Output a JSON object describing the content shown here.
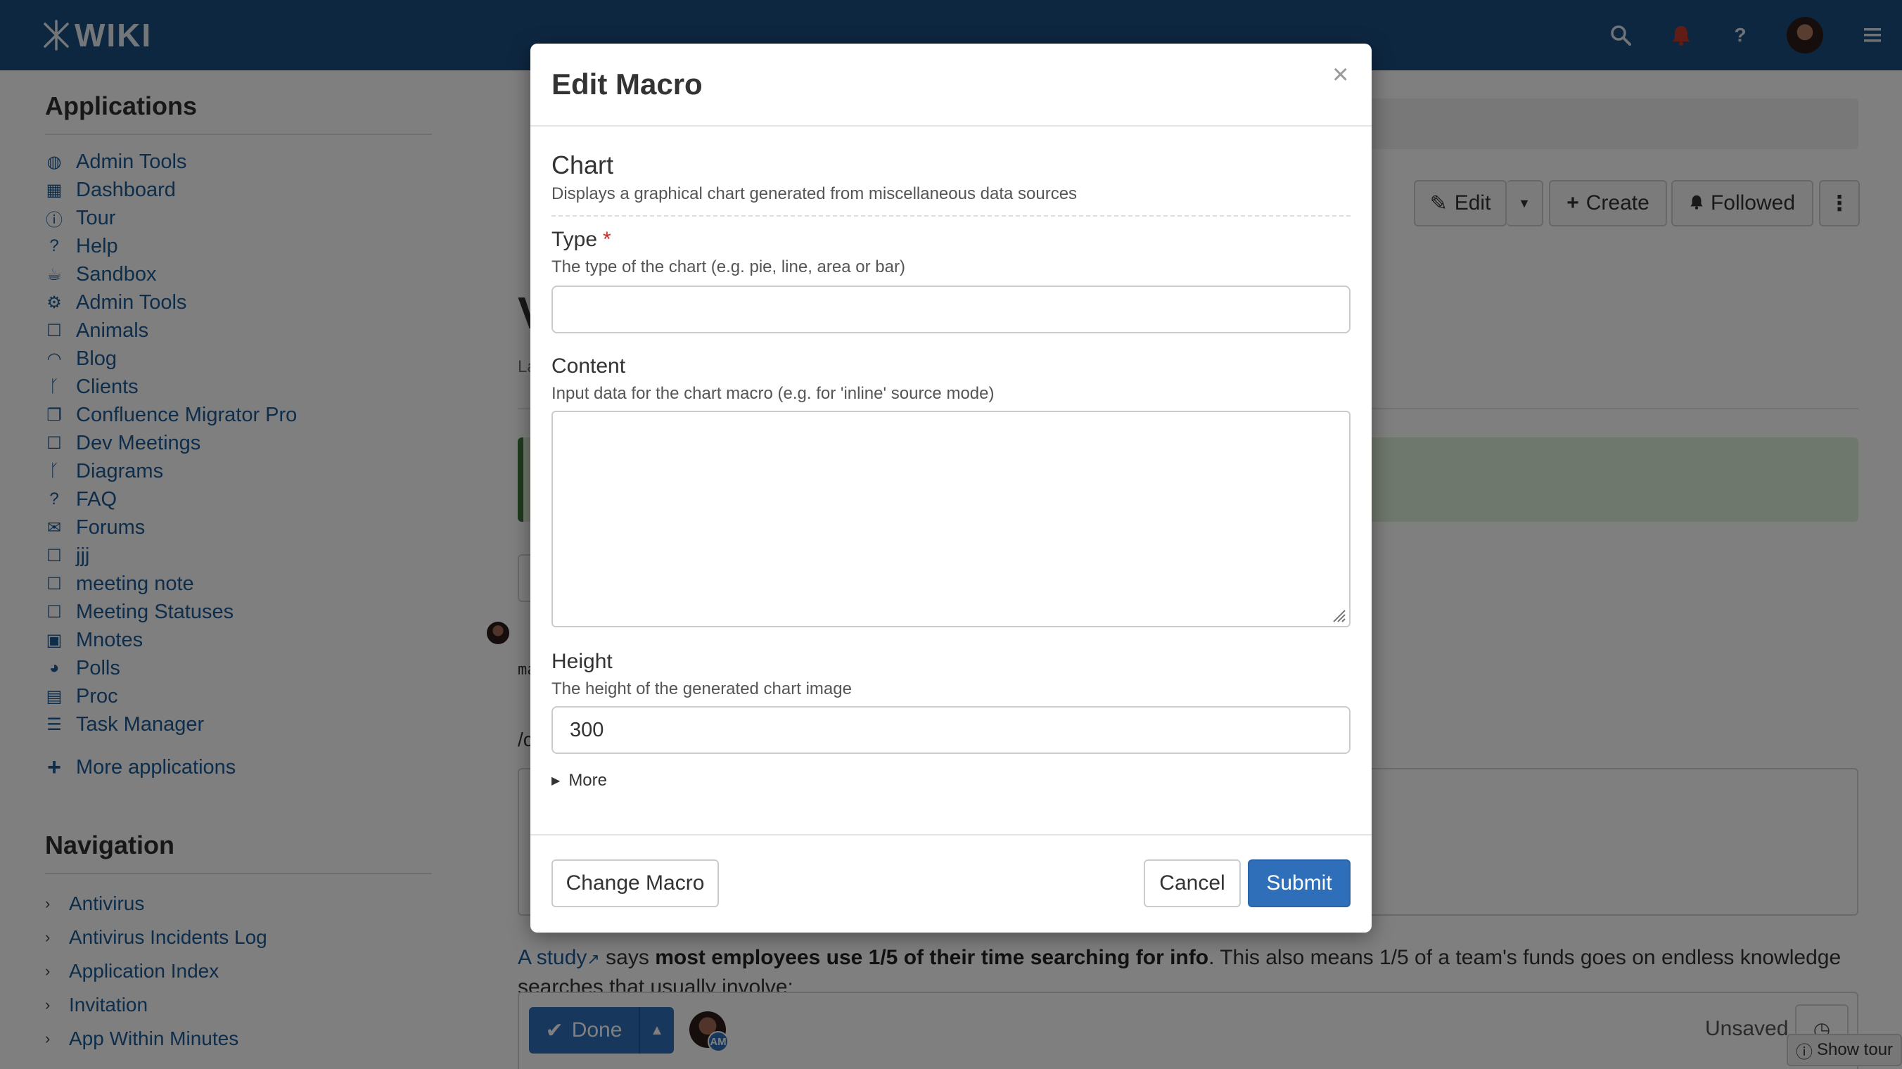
{
  "topbar": {
    "logo_text": "WIKI",
    "icons": [
      "search-icon",
      "bell-icon",
      "help-icon",
      "avatar",
      "menu-icon"
    ],
    "help_glyph": "?",
    "brand_color": "#1c4f82",
    "notification_color": "#c0392b"
  },
  "sidebar": {
    "applications_heading": "Applications",
    "apps": [
      {
        "label": "Admin Tools",
        "icon": "globe-icon"
      },
      {
        "label": "Dashboard",
        "icon": "dashboard-icon"
      },
      {
        "label": "Tour",
        "icon": "info-icon"
      },
      {
        "label": "Help",
        "icon": "question-icon"
      },
      {
        "label": "Sandbox",
        "icon": "cup-icon"
      },
      {
        "label": "Admin Tools",
        "icon": "gear-icon"
      },
      {
        "label": "Animals",
        "icon": "square-icon"
      },
      {
        "label": "Blog",
        "icon": "rss-icon"
      },
      {
        "label": "Clients",
        "icon": "branch-icon"
      },
      {
        "label": "Confluence Migrator Pro",
        "icon": "copy-icon"
      },
      {
        "label": "Dev Meetings",
        "icon": "square-icon"
      },
      {
        "label": "Diagrams",
        "icon": "branch-icon"
      },
      {
        "label": "FAQ",
        "icon": "question-icon"
      },
      {
        "label": "Forums",
        "icon": "comments-icon"
      },
      {
        "label": "jjj",
        "icon": "square-icon"
      },
      {
        "label": "meeting note",
        "icon": "square-icon"
      },
      {
        "label": "Meeting Statuses",
        "icon": "square-icon"
      },
      {
        "label": "Mnotes",
        "icon": "briefcase-icon"
      },
      {
        "label": "Polls",
        "icon": "pie-icon"
      },
      {
        "label": "Proc",
        "icon": "book-icon"
      },
      {
        "label": "Task Manager",
        "icon": "list-icon"
      }
    ],
    "more_applications": "More applications",
    "navigation_heading": "Navigation",
    "nav": [
      {
        "label": "Antivirus"
      },
      {
        "label": "Antivirus Incidents Log"
      },
      {
        "label": "Application Index"
      },
      {
        "label": "Invitation"
      },
      {
        "label": "App Within Minutes"
      }
    ]
  },
  "page": {
    "actions": {
      "edit": "Edit",
      "create": "Create",
      "followed": "Followed"
    },
    "title_fragment": "V",
    "subtitle_fragment": "La",
    "mono_fragment": "ma",
    "path_fragment": "/c",
    "study": {
      "link": "A study",
      "says": " says ",
      "bold": "most employees use 1/5 of their time searching for info",
      "rest": ". This also means 1/5 of a team's funds goes on endless knowledge searches that usually involve:"
    }
  },
  "editbar": {
    "done": "Done",
    "user_badge": "AM",
    "status": "Unsaved",
    "show_tour": "Show tour"
  },
  "modal": {
    "title": "Edit Macro",
    "close": "×",
    "macro_name": "Chart",
    "macro_description": "Displays a graphical chart generated from miscellaneous data sources",
    "fields": {
      "type": {
        "label": "Type",
        "required_mark": "*",
        "hint": "The type of the chart (e.g. pie, line, area or bar)",
        "value": ""
      },
      "content": {
        "label": "Content",
        "hint": "Input data for the chart macro (e.g. for 'inline' source mode)",
        "value": ""
      },
      "height": {
        "label": "Height",
        "hint": "The height of the generated chart image",
        "value": "300"
      }
    },
    "more_toggle": "More",
    "buttons": {
      "change_macro": "Change Macro",
      "cancel": "Cancel",
      "submit": "Submit"
    },
    "primary_color": "#2f6fba"
  }
}
